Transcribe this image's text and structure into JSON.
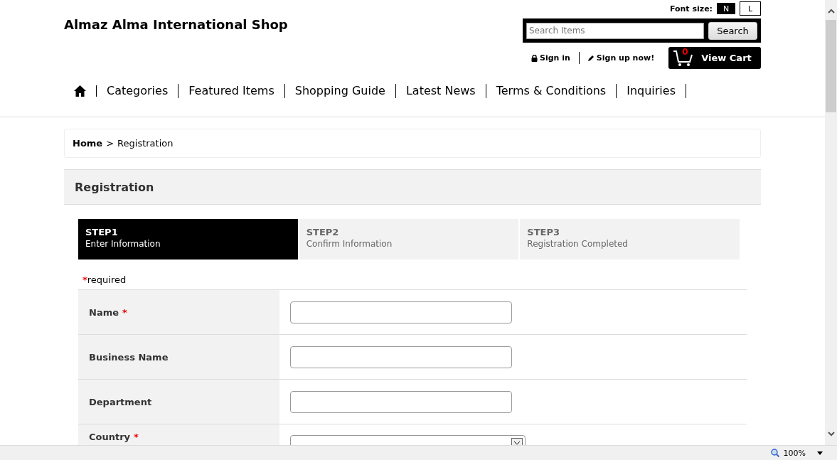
{
  "shop_title": "Almaz Alma International Shop",
  "font_size": {
    "label": "Font size:",
    "options": [
      {
        "label": "N",
        "selected": true
      },
      {
        "label": "L",
        "selected": false
      }
    ]
  },
  "search": {
    "placeholder": "Search Items",
    "button": "Search"
  },
  "account_links": [
    {
      "kind": "lock",
      "label": "Sign in"
    },
    {
      "kind": "pencil",
      "label": "Sign up now!"
    }
  ],
  "cart": {
    "count": "0",
    "label": "View Cart"
  },
  "nav": [
    "Categories",
    "Featured Items",
    "Shopping Guide",
    "Latest News",
    "Terms & Conditions",
    "Inquiries"
  ],
  "breadcrumb": {
    "home": "Home",
    "separator": ">",
    "current": "Registration"
  },
  "section_title": "Registration",
  "steps": [
    {
      "step": "STEP1",
      "label": "Enter Information",
      "selected": true
    },
    {
      "step": "STEP2",
      "label": "Confirm Information",
      "selected": false
    },
    {
      "step": "STEP3",
      "label": "Registration Completed",
      "selected": false
    }
  ],
  "required_note": {
    "mark": "*",
    "text": "required"
  },
  "fields": [
    {
      "label": "Name",
      "required": true,
      "kind": "text"
    },
    {
      "label": "Business Name",
      "required": false,
      "kind": "text"
    },
    {
      "label": "Department",
      "required": false,
      "kind": "text"
    },
    {
      "label": "Country",
      "required": true,
      "kind": "select"
    }
  ],
  "status_bar": {
    "zoom": "100%"
  }
}
